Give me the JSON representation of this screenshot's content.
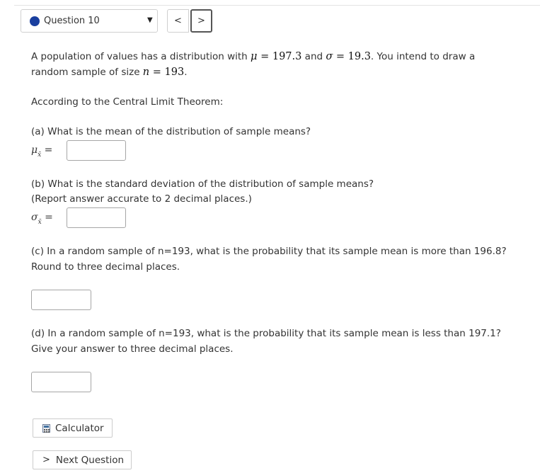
{
  "header": {
    "question_label": "Question 10",
    "prev_symbol": "<",
    "next_symbol": ">",
    "dot_color": "#1a3f9f"
  },
  "intro": {
    "p1": "A population of values has a distribution with ",
    "mu_sym": "μ",
    "mu_val": " = 197.3",
    "and": " and ",
    "sigma_sym": "σ",
    "sigma_val": " = 19.3",
    "p2": ". You intend to draw a",
    "p3": "random sample of size ",
    "n_sym": "n",
    "n_val": " = 193",
    "p4": "."
  },
  "clt": "According to the Central Limit Theorem:",
  "part_a": {
    "question": "(a) What is the mean of the distribution of sample means?",
    "label_sym": "μ",
    "label_sub": "x̄",
    "label_eq": " =",
    "value": ""
  },
  "part_b": {
    "question": "(b) What is the standard deviation of the distribution of sample means?",
    "note": "(Report answer accurate to 2 decimal places.)",
    "label_sym": "σ",
    "label_sub": "x̄",
    "label_eq": " =",
    "value": ""
  },
  "part_c": {
    "line1": "(c) In a random sample of n=193, what is the probability that its sample mean is more than 196.8?",
    "line2": "Round to three decimal places.",
    "value": ""
  },
  "part_d": {
    "line1": "(d) In a random sample of n=193, what is the probability that its sample mean is less than 197.1?",
    "line2": "Give your answer to three decimal places.",
    "value": ""
  },
  "buttons": {
    "calculator": "Calculator",
    "next_question": "Next Question",
    "next_chevron": ">"
  }
}
